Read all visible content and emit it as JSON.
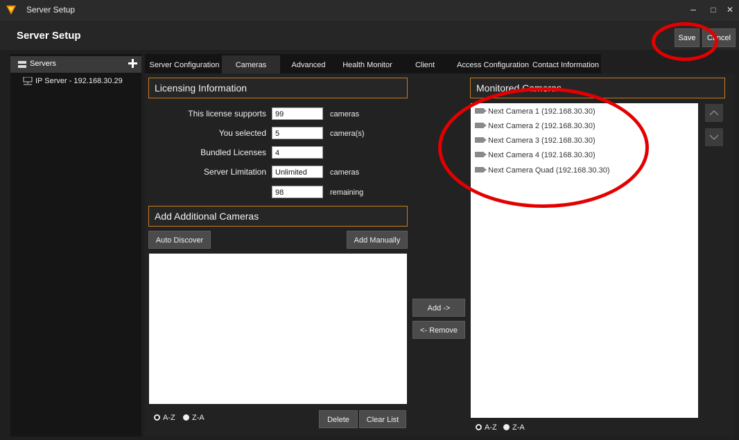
{
  "window": {
    "title": "Server Setup",
    "minimize": "–",
    "maximize": "□",
    "close": "✕"
  },
  "header": {
    "title": "Server Setup",
    "save_label": "Save",
    "cancel_label": "Cancel"
  },
  "sidebar": {
    "heading": "Servers",
    "items": [
      {
        "label": "IP Server - 192.168.30.29"
      }
    ]
  },
  "tabs": [
    {
      "label": "Server Configuration"
    },
    {
      "label": "Cameras",
      "active": true
    },
    {
      "label": "Advanced"
    },
    {
      "label": "Health Monitor"
    },
    {
      "label": "Client"
    },
    {
      "label": "Access Configuration"
    },
    {
      "label": "Contact Information"
    }
  ],
  "licensing": {
    "title": "Licensing Information",
    "rows": [
      {
        "label": "This license supports",
        "value": "99",
        "unit": "cameras"
      },
      {
        "label": "You selected",
        "value": "5",
        "unit": "camera(s)"
      },
      {
        "label": "Bundled Licenses",
        "value": "4",
        "unit": ""
      },
      {
        "label": "Server Limitation",
        "value": "Unlimited",
        "unit": "cameras"
      },
      {
        "label": "",
        "value": "98",
        "unit": "remaining"
      }
    ]
  },
  "additional": {
    "title": "Add Additional Cameras",
    "auto_discover": "Auto Discover",
    "add_manually": "Add Manually",
    "delete": "Delete",
    "clear_list": "Clear List",
    "sort_az": "A-Z",
    "sort_za": "Z-A"
  },
  "transfer": {
    "add": "Add ->",
    "remove": "<- Remove"
  },
  "monitored": {
    "title": "Monitored Cameras",
    "cameras": [
      "Next Camera 1 (192.168.30.30)",
      "Next Camera 2 (192.168.30.30)",
      "Next Camera 3 (192.168.30.30)",
      "Next Camera 4 (192.168.30.30)",
      "Next Camera Quad (192.168.30.30)"
    ],
    "sort_az": "A-Z",
    "sort_za": "Z-A"
  },
  "colors": {
    "accent_border": "#c97d1c",
    "annotation": "#e40000",
    "background": "#1f1f1f"
  }
}
